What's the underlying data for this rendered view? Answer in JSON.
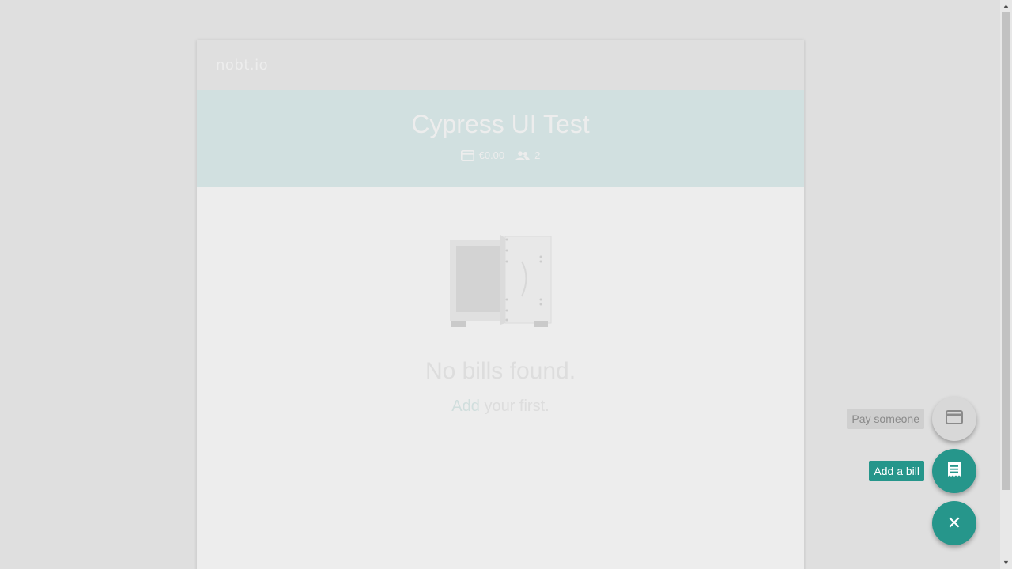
{
  "app": {
    "logo": "nobt.io"
  },
  "hero": {
    "title": "Cypress UI Test",
    "total": "€0.00",
    "members": "2"
  },
  "empty": {
    "title": "No bills found.",
    "add_link": "Add",
    "subtitle_rest": " your first."
  },
  "fab": {
    "pay_label": "Pay someone",
    "bill_label": "Add a bill",
    "close_glyph": "✕",
    "pay_icon": "credit-card-icon",
    "bill_icon": "receipt-icon",
    "close_icon": "close-icon"
  },
  "colors": {
    "accent": "#26968b",
    "hero_bg": "#e1f2f1",
    "page_bg": "#f0f0f0"
  }
}
